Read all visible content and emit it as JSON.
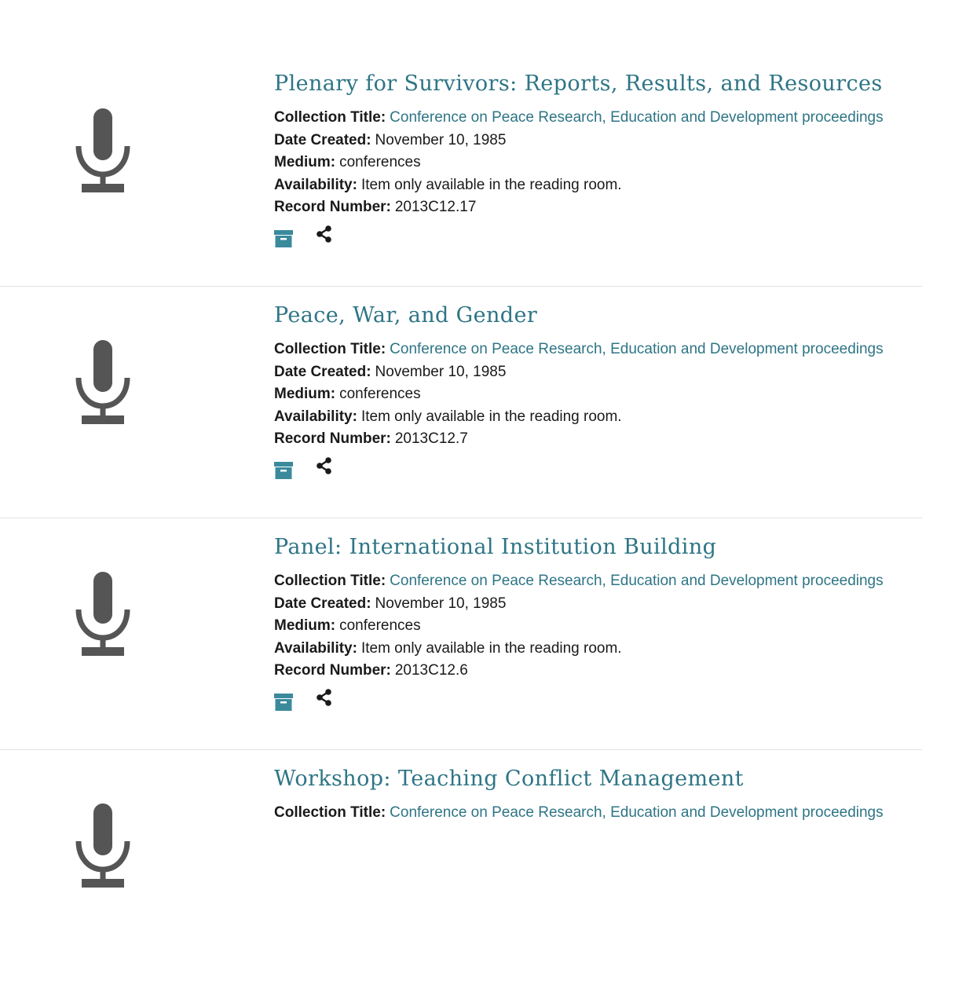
{
  "labels": {
    "collection_title": "Collection Title:",
    "date_created": "Date Created:",
    "medium": "Medium:",
    "availability": "Availability:",
    "record_number": "Record Number:"
  },
  "records": [
    {
      "title": "Plenary for Survivors: Reports, Results, and Resources",
      "collection_title": "Conference on Peace Research, Education and Development proceedings",
      "date_created": "November 10, 1985",
      "medium": "conferences",
      "availability": "Item only available in the reading room.",
      "record_number": "2013C12.17",
      "thumbnail_icon": "microphone-icon"
    },
    {
      "title": "Peace, War, and Gender",
      "collection_title": "Conference on Peace Research, Education and Development proceedings",
      "date_created": "November 10, 1985",
      "medium": "conferences",
      "availability": "Item only available in the reading room.",
      "record_number": "2013C12.7",
      "thumbnail_icon": "microphone-icon"
    },
    {
      "title": "Panel: International Institution Building",
      "collection_title": "Conference on Peace Research, Education and Development proceedings",
      "date_created": "November 10, 1985",
      "medium": "conferences",
      "availability": "Item only available in the reading room.",
      "record_number": "2013C12.6",
      "thumbnail_icon": "microphone-icon"
    },
    {
      "title": "Workshop: Teaching Conflict Management",
      "collection_title": "Conference on Peace Research, Education and Development proceedings",
      "thumbnail_icon": "microphone-icon"
    }
  ],
  "actions": {
    "archive_icon": "archive-box-icon",
    "share_icon": "share-icon"
  },
  "colors": {
    "link": "#2e7585",
    "icon_gray": "#555555",
    "archive_icon": "#3a8a9c",
    "divider": "#e2e2e2"
  }
}
